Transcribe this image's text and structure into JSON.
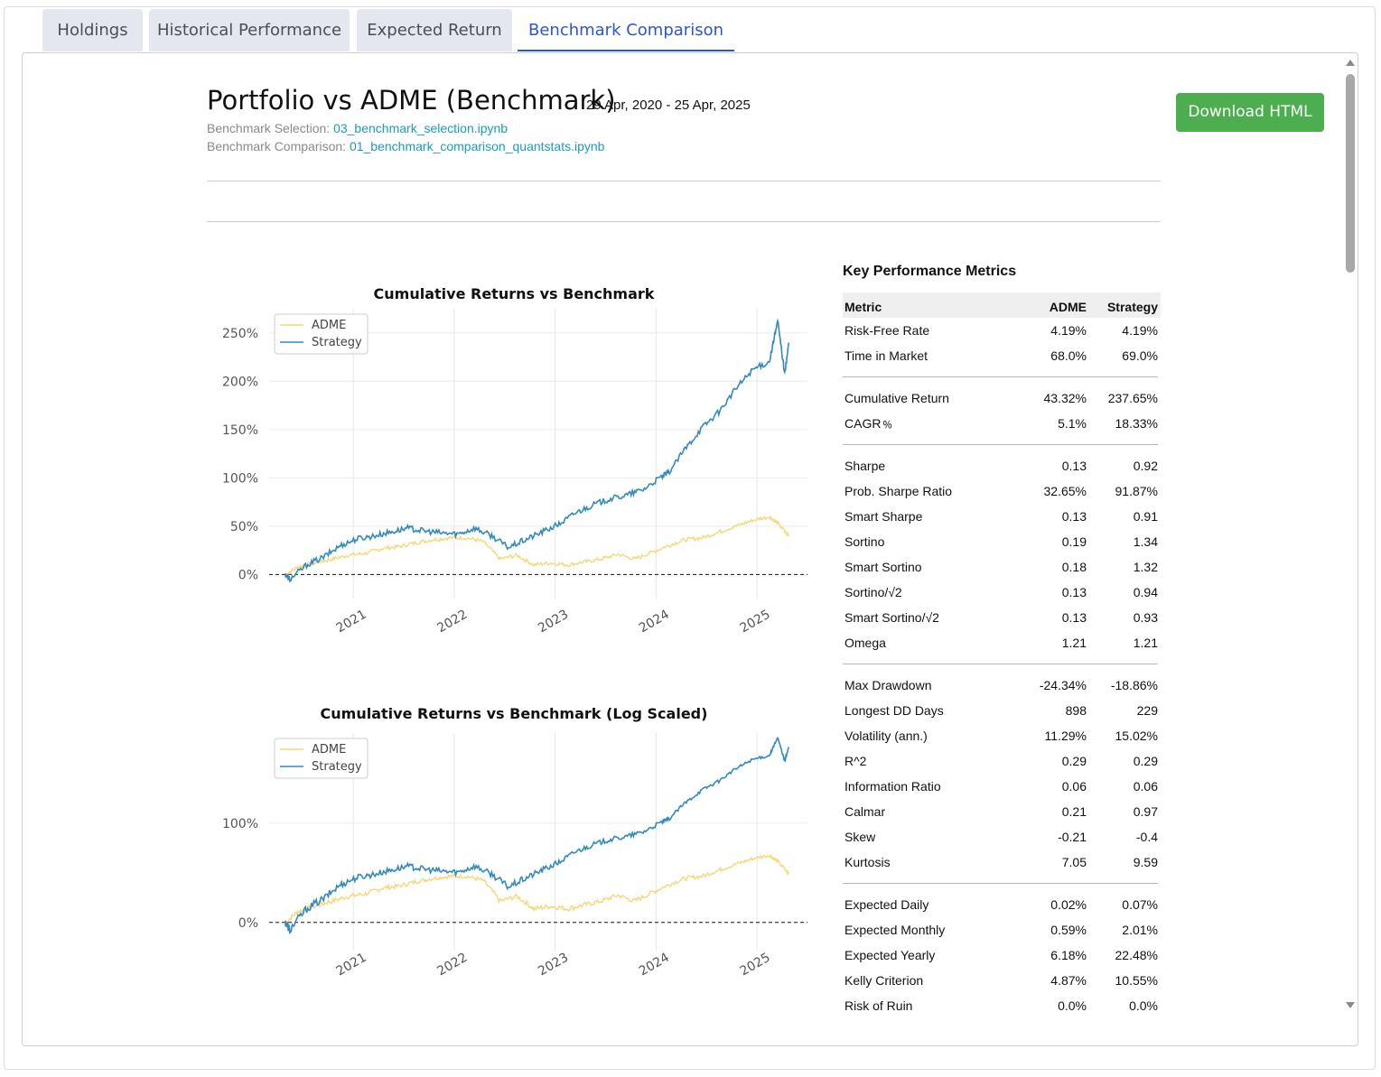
{
  "tabs": [
    {
      "label": "Holdings",
      "active": false
    },
    {
      "label": "Historical Performance",
      "active": false
    },
    {
      "label": "Expected Return",
      "active": false
    },
    {
      "label": "Benchmark Comparison",
      "active": true
    }
  ],
  "header": {
    "title": "Portfolio vs ADME (Benchmark)",
    "date_range": "29 Apr, 2020 - 25 Apr, 2025",
    "selection_label": "Benchmark Selection:",
    "selection_link": "03_benchmark_selection.ipynb",
    "comparison_label": "Benchmark Comparison:",
    "comparison_link": "01_benchmark_comparison_quantstats.ipynb",
    "download_label": "Download HTML"
  },
  "colors": {
    "accent": "#2a55d9",
    "download_bg": "#4cae4f",
    "link": "#1a9cbb",
    "benchmark": "#f5d77a",
    "strategy": "#348abd"
  },
  "chart_data": [
    {
      "type": "line",
      "title": "Cumulative Returns vs Benchmark",
      "y_ticks": [
        "0%",
        "50%",
        "100%",
        "150%",
        "200%",
        "250%"
      ],
      "y_tick_values": [
        0,
        50,
        100,
        150,
        200,
        250
      ],
      "x_ticks": [
        "2021",
        "2022",
        "2023",
        "2024",
        "2025"
      ],
      "ylim": [
        -8,
        275
      ],
      "xlim": [
        "2020-03-01",
        "2025-07-01"
      ],
      "log_scale": false,
      "grid": true,
      "legend": "top-left",
      "series": [
        {
          "name": "ADME",
          "color": "#f5d77a",
          "x": [
            "2020-04-29",
            "2020-06",
            "2020-08",
            "2020-10",
            "2020-12",
            "2021-02",
            "2021-04",
            "2021-06",
            "2021-08",
            "2021-10",
            "2021-12",
            "2022-02",
            "2022-04",
            "2022-06",
            "2022-08",
            "2022-10",
            "2022-12",
            "2023-02",
            "2023-04",
            "2023-06",
            "2023-08",
            "2023-10",
            "2023-12",
            "2024-02",
            "2024-04",
            "2024-06",
            "2024-08",
            "2024-10",
            "2024-12",
            "2025-02",
            "2025-03",
            "2025-04-25"
          ],
          "y": [
            0,
            8,
            12,
            16,
            20,
            22,
            27,
            29,
            33,
            36,
            38,
            38,
            34,
            16,
            20,
            10,
            12,
            10,
            13,
            16,
            21,
            16,
            23,
            30,
            36,
            38,
            44,
            50,
            56,
            60,
            53,
            40
          ]
        },
        {
          "name": "Strategy",
          "color": "#348abd",
          "x": [
            "2020-04-29",
            "2020-05",
            "2020-07",
            "2020-09",
            "2020-11",
            "2021-01",
            "2021-03",
            "2021-05",
            "2021-07",
            "2021-09",
            "2021-11",
            "2022-01",
            "2022-03",
            "2022-05",
            "2022-07",
            "2022-09",
            "2022-11",
            "2023-01",
            "2023-03",
            "2023-05",
            "2023-07",
            "2023-09",
            "2023-11",
            "2024-01",
            "2024-02",
            "2024-04",
            "2024-06",
            "2024-08",
            "2024-10",
            "2024-12",
            "2025-02",
            "2025-03",
            "2025-04-10",
            "2025-04-25"
          ],
          "y": [
            0,
            -5,
            10,
            18,
            30,
            37,
            40,
            44,
            48,
            45,
            43,
            42,
            48,
            40,
            28,
            36,
            44,
            52,
            64,
            72,
            78,
            82,
            88,
            100,
            105,
            130,
            152,
            168,
            192,
            212,
            220,
            262,
            208,
            240
          ]
        }
      ]
    },
    {
      "type": "line",
      "title": "Cumulative Returns vs Benchmark (Log Scaled)",
      "y_ticks": [
        "0%",
        "100%"
      ],
      "y_tick_values": [
        0,
        100
      ],
      "x_ticks": [
        "2021",
        "2022",
        "2023",
        "2024",
        "2025"
      ],
      "ylim": [
        -8,
        275
      ],
      "xlim": [
        "2020-03-01",
        "2025-07-01"
      ],
      "log_scale": true,
      "grid": true,
      "legend": "top-left",
      "series": [
        {
          "name": "ADME",
          "color": "#f5d77a"
        },
        {
          "name": "Strategy",
          "color": "#348abd"
        }
      ]
    }
  ],
  "metrics": {
    "title": "Key Performance Metrics",
    "columns": [
      "Metric",
      "ADME",
      "Strategy"
    ],
    "groups": [
      [
        [
          "Risk-Free Rate",
          "4.19%",
          "4.19%"
        ],
        [
          "Time in Market",
          "68.0%",
          "69.0%"
        ]
      ],
      [
        [
          "Cumulative Return",
          "43.32%",
          "237.65%"
        ],
        [
          "CAGR﹪",
          "5.1%",
          "18.33%"
        ]
      ],
      [
        [
          "Sharpe",
          "0.13",
          "0.92"
        ],
        [
          "Prob. Sharpe Ratio",
          "32.65%",
          "91.87%"
        ],
        [
          "Smart Sharpe",
          "0.13",
          "0.91"
        ],
        [
          "Sortino",
          "0.19",
          "1.34"
        ],
        [
          "Smart Sortino",
          "0.18",
          "1.32"
        ],
        [
          "Sortino/√2",
          "0.13",
          "0.94"
        ],
        [
          "Smart Sortino/√2",
          "0.13",
          "0.93"
        ],
        [
          "Omega",
          "1.21",
          "1.21"
        ]
      ],
      [
        [
          "Max Drawdown",
          "-24.34%",
          "-18.86%"
        ],
        [
          "Longest DD Days",
          "898",
          "229"
        ],
        [
          "Volatility (ann.)",
          "11.29%",
          "15.02%"
        ],
        [
          "R^2",
          "0.29",
          "0.29"
        ],
        [
          "Information Ratio",
          "0.06",
          "0.06"
        ],
        [
          "Calmar",
          "0.21",
          "0.97"
        ],
        [
          "Skew",
          "-0.21",
          "-0.4"
        ],
        [
          "Kurtosis",
          "7.05",
          "9.59"
        ]
      ],
      [
        [
          "Expected Daily",
          "0.02%",
          "0.07%"
        ],
        [
          "Expected Monthly",
          "0.59%",
          "2.01%"
        ],
        [
          "Expected Yearly",
          "6.18%",
          "22.48%"
        ],
        [
          "Kelly Criterion",
          "4.87%",
          "10.55%"
        ],
        [
          "Risk of Ruin",
          "0.0%",
          "0.0%"
        ]
      ]
    ]
  }
}
